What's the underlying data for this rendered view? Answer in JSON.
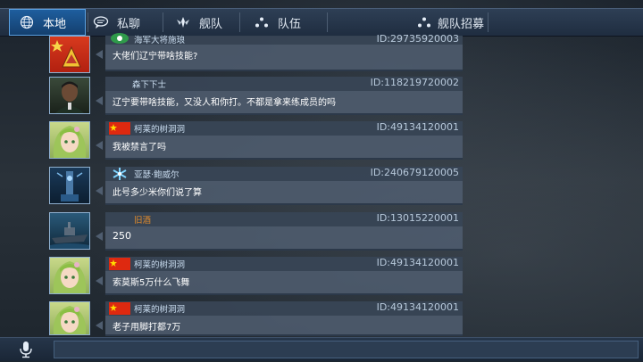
{
  "tabs": [
    {
      "label": "本地",
      "icon": "globe-icon",
      "active": true
    },
    {
      "label": "私聊",
      "icon": "chat-bubble-icon"
    },
    {
      "label": "舰队",
      "icon": "fleet-emblem-icon"
    },
    {
      "label": "队伍",
      "icon": "team-dots-icon"
    },
    {
      "label": "舰队招募",
      "icon": "recruit-dots-icon"
    }
  ],
  "messages": [
    {
      "name": "海军大将施琅",
      "uid": "ID:29735920003",
      "text": "大佬们辽宁带啥技能?",
      "flag": "badge-green"
    },
    {
      "name": "森下下士",
      "uid": "ID:118219720002",
      "text": "辽宁要带啥技能，又没人和你打。不都是拿来练成员的吗",
      "flag": "none"
    },
    {
      "name": "柯莱的树洞洞",
      "uid": "ID:49134120001",
      "text": "我被禁言了吗",
      "flag": "red"
    },
    {
      "name": "亚瑟·鲍威尔",
      "uid": "ID:240679120005",
      "text": "此号多少米你们说了算",
      "flag": "snowflake"
    },
    {
      "name": "旧酒",
      "uid": "ID:13015220001",
      "text": "250",
      "flag": "none",
      "name_color": "#e08a2c"
    },
    {
      "name": "柯莱的树洞洞",
      "uid": "ID:49134120001",
      "text": "索莫斯5万什么飞舞",
      "flag": "red"
    },
    {
      "name": "柯莱的树洞洞",
      "uid": "ID:49134120001",
      "text": "老子用脚打都7万",
      "flag": "red"
    }
  ],
  "bottom": {
    "mic_icon": "microphone-icon",
    "input_value": ""
  },
  "colors": {
    "accent": "#1e5e9e",
    "bubble": "#4e5c6e",
    "name_orange": "#e08a2c"
  }
}
